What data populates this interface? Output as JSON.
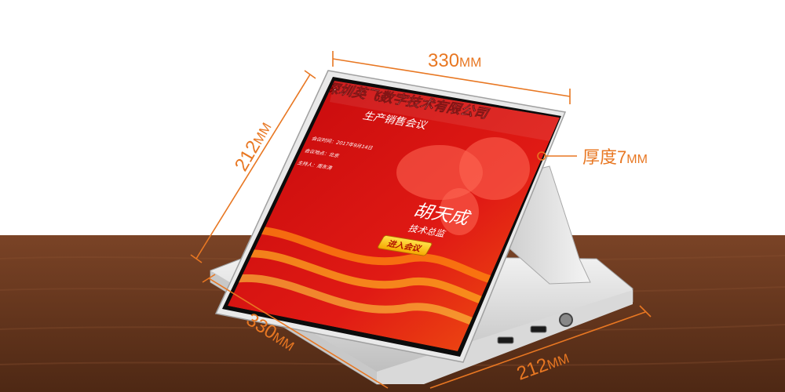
{
  "dimensions": {
    "top_width": {
      "value": "330",
      "unit": "MM"
    },
    "left_height": {
      "value": "212",
      "unit": "MM"
    },
    "thickness": {
      "label": "厚度",
      "value": "7",
      "unit": "MM"
    },
    "bottom_width": {
      "value": "330",
      "unit": "MM"
    },
    "bottom_depth": {
      "value": "212",
      "unit": "MM"
    }
  },
  "screen": {
    "company": "深圳英飞数字技术有限公司",
    "meeting": "生产销售会议",
    "info": [
      "会议时间：2017年9月14日",
      "会议地点：北京",
      "主持人：周东涛"
    ],
    "person_name": "胡天成",
    "person_title": "技术总监",
    "enter_button": "进入会议"
  },
  "colors": {
    "accent": "#e87722",
    "screen_red": "#d40c10",
    "button": "#ffc400",
    "table": "#6e3a1e"
  }
}
